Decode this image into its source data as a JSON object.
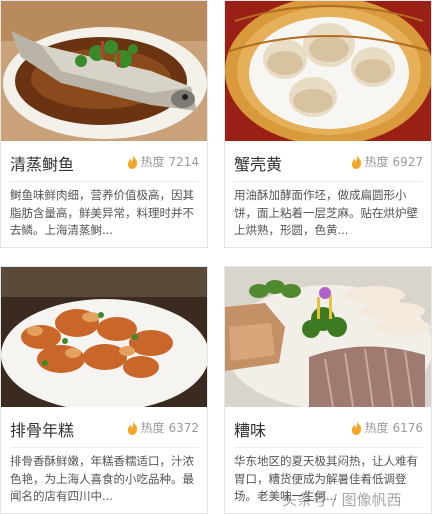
{
  "cards": [
    {
      "title": "清蒸鲥鱼",
      "heat_label": "热度",
      "heat_value": "7214",
      "desc": "鲥鱼味鲜肉细，营养价值极高，因其脂肪含量高，鲜美异常，料理时并不去鳞。上海清蒸鲥...",
      "image": "steamed-fish-photo"
    },
    {
      "title": "蟹壳黄",
      "heat_label": "热度",
      "heat_value": "6927",
      "desc": "用油酥加酵面作坯，做成扁圆形小饼，面上粘着一层芝麻。贴在烘炉壁上烘熟，形圆，色黄...",
      "image": "sesame-cakes-photo"
    },
    {
      "title": "排骨年糕",
      "heat_label": "热度",
      "heat_value": "6372",
      "desc": "排骨香酥鲜嫩，年糕香糯适口，汁浓色艳，为上海人喜食的小吃品种。最闻名的店有四川中...",
      "image": "pork-rice-cake-photo"
    },
    {
      "title": "糟味",
      "heat_label": "热度",
      "heat_value": "6176",
      "desc": "华东地区的夏天极其闷热，让人难有胃口，糟货便成为解暑佳肴低调登场。老美味一生何...",
      "image": "marinated-platter-photo"
    }
  ],
  "flame_color": "#f5a623",
  "watermark": "头条号 / 图像帆西"
}
